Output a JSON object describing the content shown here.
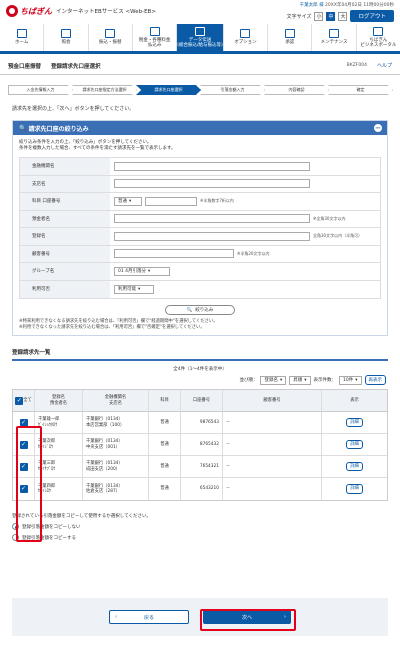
{
  "header": {
    "brand": "ちばぎん",
    "service": "インターネットEBサービス <Web-EB>",
    "user": "千葉太郎 様",
    "login_time": "20XX年04月02日 11時00分00秒",
    "font_size_label": "文字サイズ",
    "font_small": "小",
    "font_mid": "中",
    "font_large": "大",
    "logout": "ログアウト"
  },
  "nav": [
    {
      "label": "ホーム",
      "icon": "home-icon"
    },
    {
      "label": "照会",
      "icon": "inquiry-icon"
    },
    {
      "label": "振込・振替",
      "icon": "transfer-icon"
    },
    {
      "label": "税金・各種料金\n払込み",
      "icon": "payment-icon"
    },
    {
      "label": "データ伝送\n(総合振込/給与振込等)",
      "icon": "data-icon",
      "active": true
    },
    {
      "label": "オプション",
      "icon": "option-icon"
    },
    {
      "label": "承認",
      "icon": "approve-icon"
    },
    {
      "label": "メンテナンス",
      "icon": "maintenance-icon"
    },
    {
      "label": "ちばぎん\nビジネスポータル",
      "icon": "portal-icon"
    }
  ],
  "title": {
    "category": "預金口座振替",
    "page": "登録請求先口座選択",
    "code": "BKZF004",
    "help": "ヘルプ"
  },
  "steps": [
    "入金先情報入力",
    "請求先口座指定方法選択",
    "請求先口座選択",
    "引落金額入力",
    "内容確認",
    "確定"
  ],
  "message": "請求先を選択の上、「次へ」ボタンを押してください。",
  "filter": {
    "title": "請求先口座の絞り込み",
    "note1": "絞り込み条件を入力の上、「絞り込み」ボタンを押してください。",
    "note2": "条件を複数入力した場合、すべての条件を満たす請求先を一覧で表示します。",
    "fields": {
      "bank": "金融機関名",
      "branch": "支店名",
      "account": "科目 口座番号",
      "account_type": "普通",
      "account_hint": "※半角数字7桁以内",
      "name_kana": "預金者名",
      "name_kana_hint": "※全角30文字以内",
      "reg_name": "登録名",
      "reg_name_hint": "全角30文字以内（半角可）",
      "cust_no": "顧客番号",
      "cust_no_hint": "※半角20文字以内",
      "group": "グループ名",
      "group_value": "01 4月引落分",
      "status": "利用可否",
      "status_value": "利用可能"
    },
    "button": "絞り込み",
    "foot1": "※特来利用できなくなる請求先を絞り込む場合は、「利用可否」欄で\"経過期間中\"を選択してください。",
    "foot2": "※利用できなくなった請求先を絞り込む場合は、「利用可否」欄で\"否確定\"を選択してください。"
  },
  "list": {
    "title": "登録請求先一覧",
    "count": "全4件（1～4件を表示中）",
    "sort_label": "並び順：",
    "sort_value": "登録名",
    "order_value": "昇順",
    "per_page_label": "表示件数：",
    "per_page_value": "10件",
    "redisplay": "再表示",
    "headers": {
      "all": "全て",
      "name": "登録名\n預金者名",
      "bank": "金融機関名\n支店名",
      "type": "科目",
      "acct": "口座番号",
      "cust": "顧客番号",
      "view": "表示"
    },
    "rows": [
      {
        "name": "千葉雄一郎\nｾﾞｲｼｮｳﾀﾛｳ",
        "bank": "千葉銀行（0134）\n本店営業部（100）",
        "type": "普通",
        "acct": "9876543",
        "cust": "－",
        "detail": "詳細"
      },
      {
        "name": "千葉次郎\nｾﾞｲｼﾞﾛｳ",
        "bank": "千葉銀行（0134）\n中央支店（001）",
        "type": "普通",
        "acct": "8765432",
        "cust": "－",
        "detail": "詳細"
      },
      {
        "name": "千葉三郎\nｾﾞｲｻﾌﾞﾛｳ",
        "bank": "千葉銀行（0134）\n成田支店（200）",
        "type": "普通",
        "acct": "7654321",
        "cust": "－",
        "detail": "詳細"
      },
      {
        "name": "千葉四郎\nｾﾞｲｼﾛｳ",
        "bank": "千葉銀行（0134）\n佐倉支店（287）",
        "type": "普通",
        "acct": "6543210",
        "cust": "－",
        "detail": "詳細"
      }
    ]
  },
  "copy": {
    "note": "登録されている引落金額をコピーして使用するか選択してください。",
    "opt1": "登録引落金額をコピーしない",
    "opt2": "登録引落金額をコピーする"
  },
  "buttons": {
    "back": "戻る",
    "next": "次へ"
  }
}
